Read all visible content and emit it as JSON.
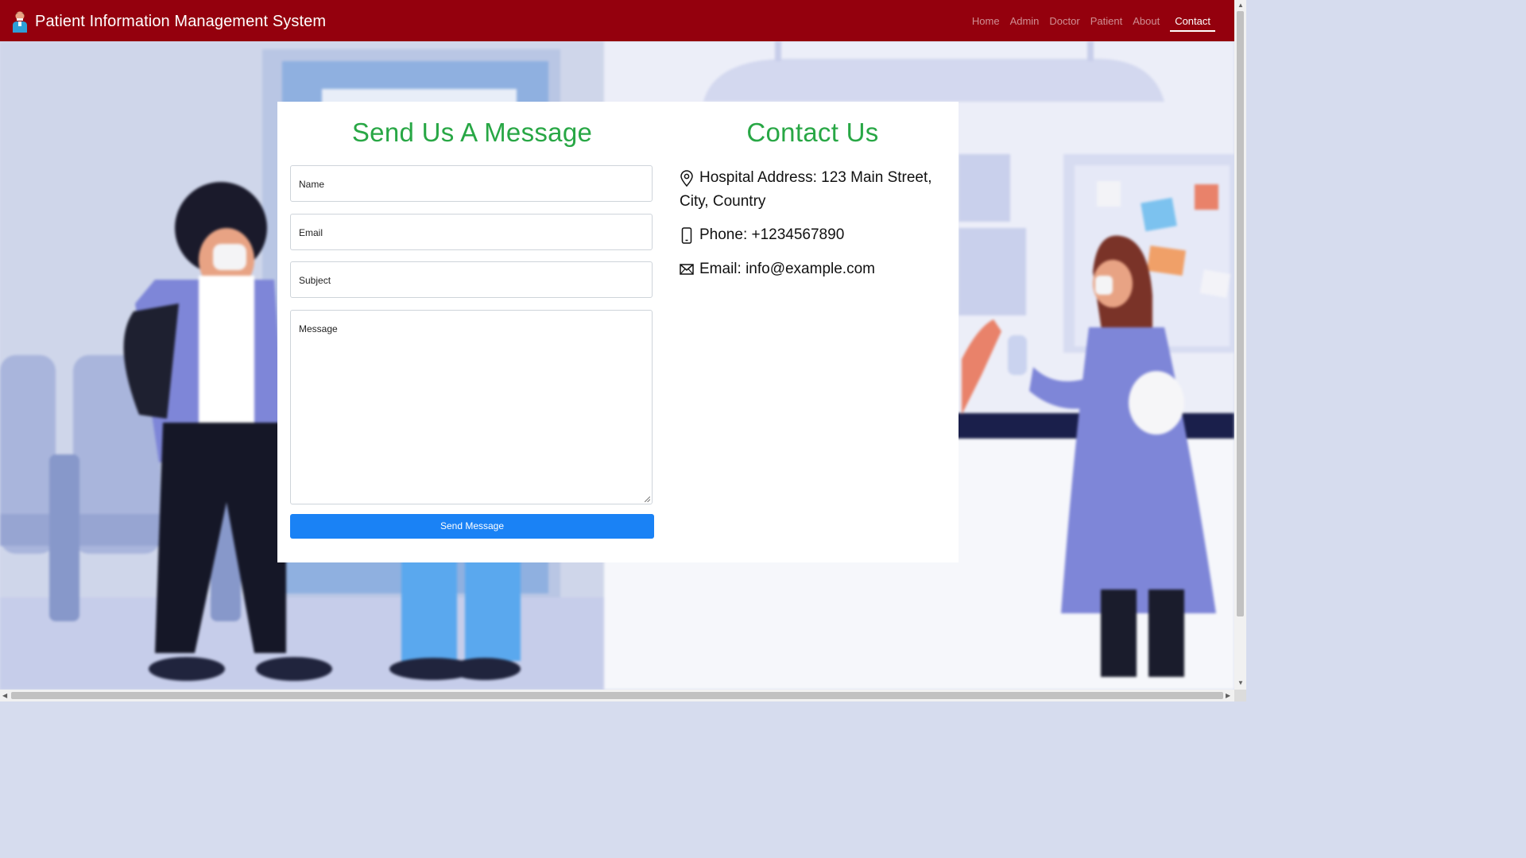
{
  "navbar": {
    "brand": "Patient Information Management System",
    "links": [
      "Home",
      "Admin",
      "Doctor",
      "Patient",
      "About",
      "Contact"
    ],
    "active": "Contact"
  },
  "form": {
    "heading": "Send Us A Message",
    "name_placeholder": "Name",
    "email_placeholder": "Email",
    "subject_placeholder": "Subject",
    "message_placeholder": "Message",
    "submit_label": "Send Message"
  },
  "contact": {
    "heading": "Contact Us",
    "address_line1": "Hospital Address: 123 Main Street,",
    "address_line2": "City, Country",
    "phone": "Phone: +1234567890",
    "email": "Email: info@example.com"
  },
  "colors": {
    "navbar": "#94000d",
    "heading": "#28a745",
    "button": "#1a82f5"
  },
  "icons": [
    "user-doctor-icon",
    "map-pin-icon",
    "phone-icon",
    "envelope-icon"
  ]
}
